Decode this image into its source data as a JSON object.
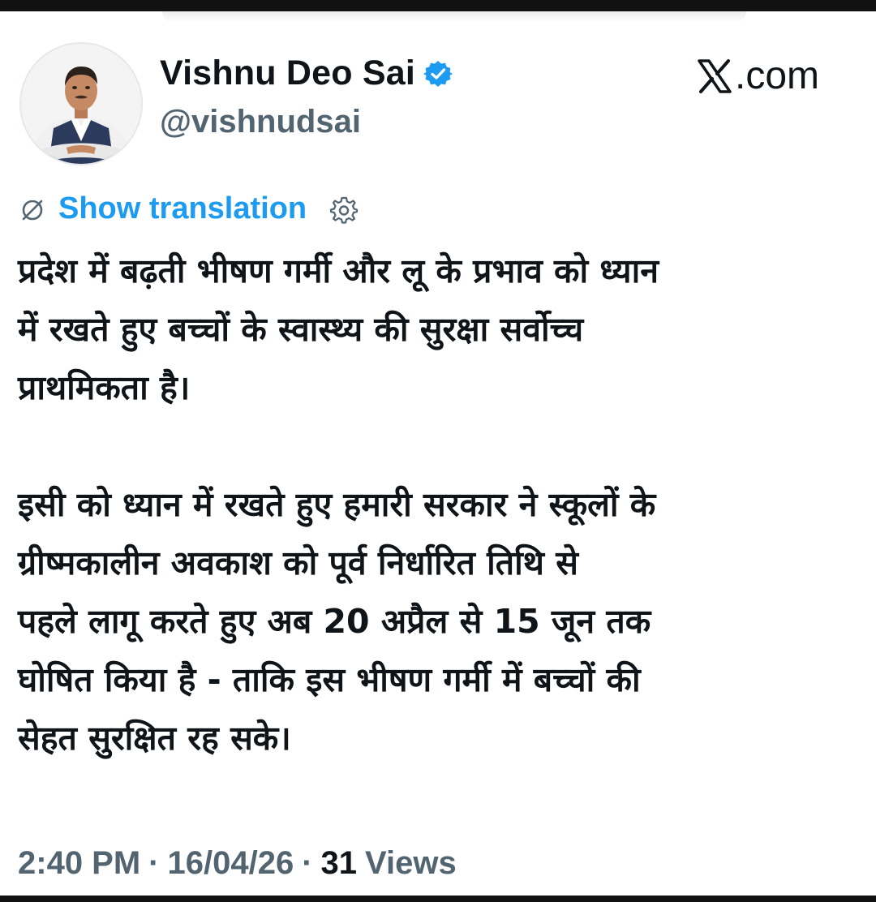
{
  "brand": "𝕏.com",
  "brand_suffix": ".com",
  "author": {
    "display_name": "Vishnu Deo Sai",
    "handle": "@vishnudsai",
    "verified": true,
    "badge_color": "#1d9bf0"
  },
  "translation": {
    "label": "Show translation",
    "icon": "translate-icon",
    "settings_icon": "gear-icon"
  },
  "tweet": {
    "paragraphs": [
      "प्रदेश में बढ़ती भीषण गर्मी और लू के प्रभाव को ध्यान\nमें रखते हुए बच्चों के स्वास्थ्य की सुरक्षा सर्वोच्च\nप्राथमिकता है।",
      "इसी को ध्यान में रखते हुए हमारी सरकार ने स्कूलों के\nग्रीष्मकालीन अवकाश को पूर्व निर्धारित तिथि से\nपहले लागू करते हुए अब 20 अप्रैल से 15 जून तक\nघोषित किया है - ताकि इस भीषण गर्मी में बच्चों की\nसेहत सुरक्षित रह सके।"
    ]
  },
  "meta": {
    "time": "2:40 PM",
    "separator": "·",
    "date": "16/04/26",
    "views_count": "31",
    "views_label": "Views"
  },
  "colors": {
    "text": "#0f1419",
    "secondary": "#536471",
    "link": "#1d9bf0"
  }
}
